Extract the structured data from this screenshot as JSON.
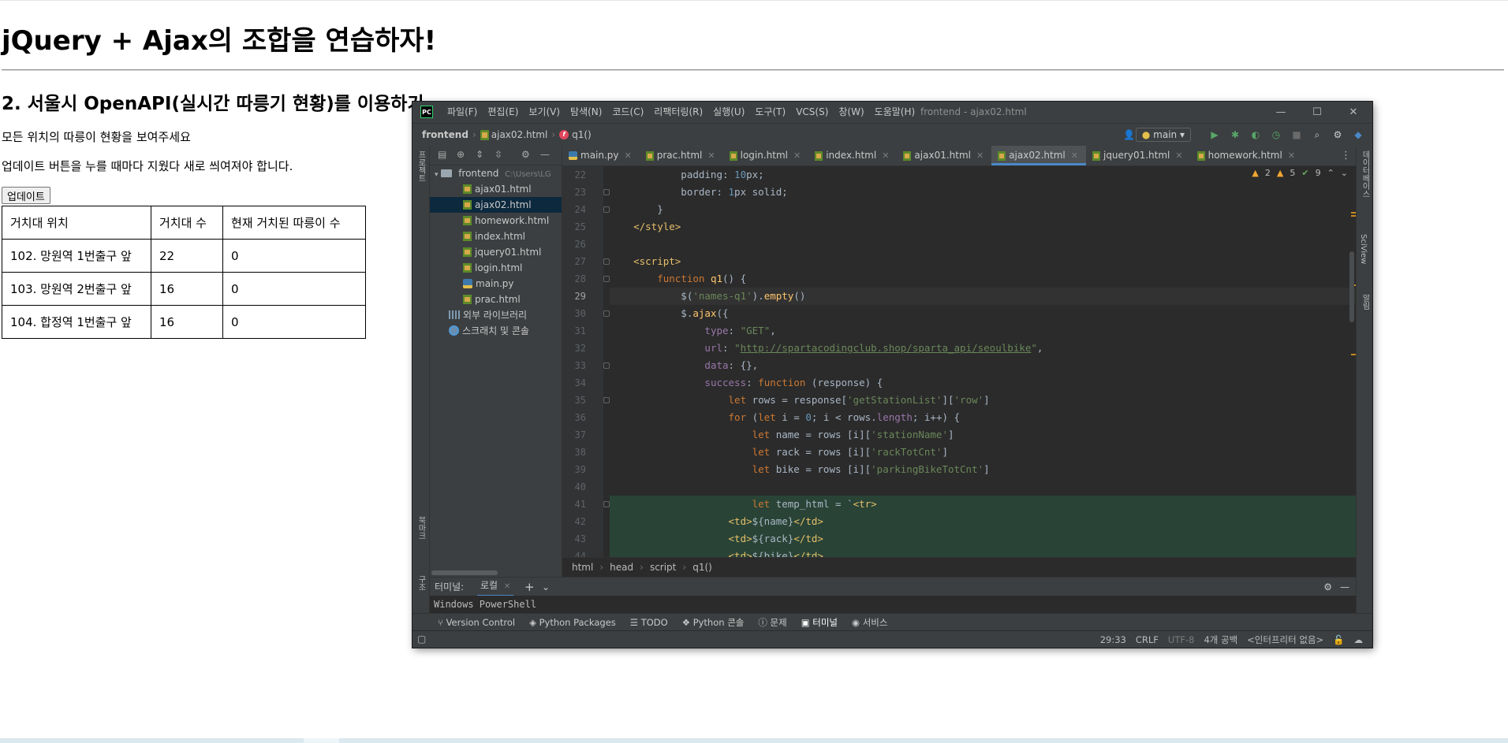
{
  "page": {
    "title": "jQuery + Ajax의 조합을 연습하자!",
    "subtitle": "2. 서울시 OpenAPI(실시간 따릉기 현황)를 이용하기",
    "desc1": "모든 위치의 따릉이 현황을 보여주세요",
    "desc2": "업데이트 버튼을 누를 때마다 지웠다 새로 씌여져야 합니다.",
    "update_button": "업데이트",
    "table": {
      "headers": [
        "거치대 위치",
        "거치대 수",
        "현재 거치된 따릉이 수"
      ],
      "rows": [
        [
          "102. 망원역 1번출구 앞",
          "22",
          "0"
        ],
        [
          "103. 망원역 2번출구 앞",
          "16",
          "0"
        ],
        [
          "104. 합정역 1번출구 앞",
          "16",
          "0"
        ]
      ]
    }
  },
  "ide": {
    "logo": "PC",
    "menu": [
      "파일(F)",
      "편집(E)",
      "보기(V)",
      "탐색(N)",
      "코드(C)",
      "리팩터링(R)",
      "실행(U)",
      "도구(T)",
      "VCS(S)",
      "창(W)",
      "도움말(H)"
    ],
    "window_title": "frontend - ajax02.html",
    "window_controls": {
      "minimize": "—",
      "maximize": "☐",
      "close": "✕"
    },
    "breadcrumb": {
      "project": "frontend",
      "file": "ajax02.html",
      "func": "q1()"
    },
    "branch": "main",
    "side_labels": {
      "project": "프로젝트",
      "bookmarks": "북마크",
      "structure": "구조",
      "database": "데이터베이스",
      "sciview": "SciView",
      "notifications": "알림"
    },
    "tree": {
      "root": "frontend",
      "root_path": "C:\\Users\\LG",
      "files": [
        "ajax01.html",
        "ajax02.html",
        "homework.html",
        "index.html",
        "jquery01.html",
        "login.html",
        "main.py",
        "prac.html"
      ],
      "selected": "ajax02.html",
      "external": "외부 라이브러리",
      "scratch": "스크래치 및 콘솔"
    },
    "tabs": [
      "main.py",
      "prac.html",
      "login.html",
      "index.html",
      "ajax01.html",
      "ajax02.html",
      "jquery01.html",
      "homework.html"
    ],
    "active_tab": "ajax02.html",
    "inspections": {
      "warnings": "2",
      "weak": "5",
      "ok": "9"
    },
    "line_numbers": [
      "22",
      "23",
      "24",
      "25",
      "26",
      "27",
      "28",
      "29",
      "30",
      "31",
      "32",
      "33",
      "34",
      "35",
      "36",
      "37",
      "38",
      "39",
      "40",
      "41",
      "42",
      "43",
      "44"
    ],
    "code_breadcrumb": [
      "html",
      "head",
      "script",
      "q1()"
    ],
    "terminal": {
      "label": "터미널:",
      "tab": "로컬",
      "content": "Windows PowerShell"
    },
    "toolwindows": [
      "Version Control",
      "Python Packages",
      "TODO",
      "Python 콘솔",
      "문제",
      "터미널",
      "서비스"
    ],
    "status": {
      "position": "29:33",
      "line_sep": "CRLF",
      "encoding": "UTF-8",
      "indent": "4개 공백",
      "interpreter": "<인터프리터 없음>"
    }
  },
  "colors": {
    "accent": "#4a88c7",
    "ide_bg": "#2b2b2b",
    "panel_bg": "#3c3f41",
    "keyword": "#cc7832",
    "string": "#6a8759"
  }
}
